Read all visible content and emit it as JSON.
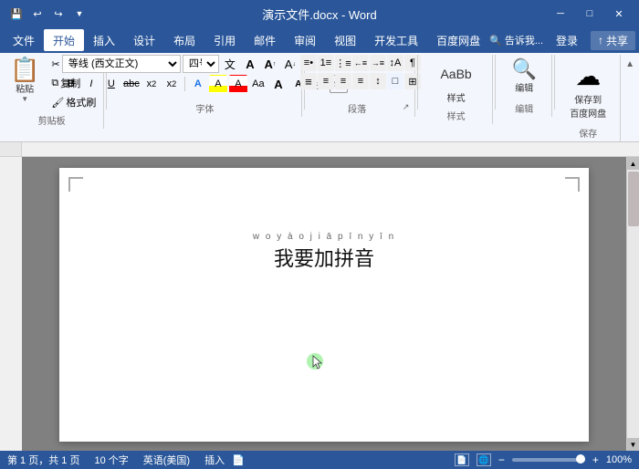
{
  "titlebar": {
    "title": "演示文件.docx - Word",
    "quickaccess": [
      "save",
      "undo",
      "redo",
      "customize"
    ],
    "wincontrols": [
      "minimize",
      "maximize",
      "close"
    ]
  },
  "menubar": {
    "items": [
      "文件",
      "开始",
      "插入",
      "设计",
      "布局",
      "引用",
      "邮件",
      "审阅",
      "视图",
      "开发工具",
      "百度网盘"
    ],
    "active": "开始",
    "right_items": [
      "告诉我...",
      "登录",
      "共享"
    ]
  },
  "ribbon": {
    "groups": [
      {
        "label": "剪贴板",
        "id": "clipboard"
      },
      {
        "label": "字体",
        "id": "font"
      },
      {
        "label": "段落",
        "id": "paragraph"
      },
      {
        "label": "样式",
        "id": "styles"
      },
      {
        "label": "编辑",
        "id": "editing"
      },
      {
        "label": "保存",
        "id": "save"
      }
    ],
    "font": {
      "name": "等线 (西文正文)",
      "size": "四号",
      "wen": "文",
      "A_btn": "A"
    },
    "styles": [
      "样式",
      "编辑"
    ],
    "save_label": "保存到\n百度网盘"
  },
  "document": {
    "pinyin": "w o y à o j i ā p ī n y ī n",
    "text": "我要加拼音",
    "page_info": "第 1 页，共 1 页",
    "word_count": "10 个字",
    "language": "英语(美国)",
    "mode": "插入",
    "zoom": "100%"
  },
  "statusbar": {
    "page": "第 1 页，共 1 页",
    "words": "10 个字",
    "language": "英语(美国)",
    "mode": "插入",
    "zoom": "100%"
  },
  "icons": {
    "save": "💾",
    "undo": "↩",
    "redo": "↪",
    "paste": "📋",
    "cut": "✂",
    "copy": "⧉",
    "format_painter": "🖌",
    "bold": "B",
    "italic": "I",
    "underline": "U",
    "strikethrough": "abc",
    "subscript": "x₂",
    "superscript": "x²",
    "font_color": "A",
    "highlight": "A",
    "increase_font": "A↑",
    "decrease_font": "A↓",
    "clear_format": "A✕",
    "list_bullet": "≡",
    "list_number": "≡",
    "indent_less": "←≡",
    "indent_more": "→≡",
    "align_left": "≡",
    "align_center": "≡",
    "align_right": "≡",
    "justify": "≡",
    "line_spacing": "↕",
    "shading": "☐",
    "borders": "⊞",
    "sort": "↕",
    "show_marks": "¶",
    "minimize": "─",
    "maximize": "□",
    "close": "✕",
    "collapse": "▲",
    "search": "🔍",
    "share_icon": "↑"
  }
}
